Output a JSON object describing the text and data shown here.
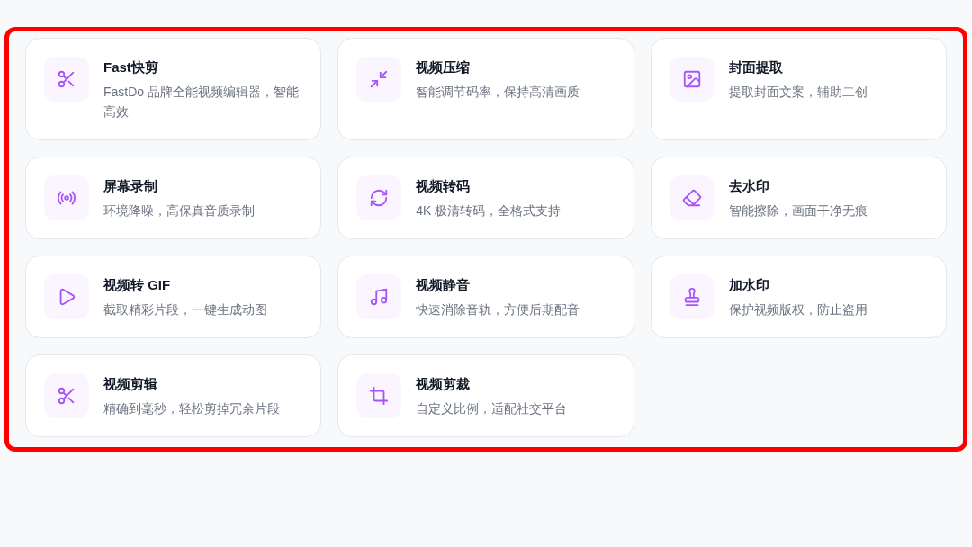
{
  "tools_grid": {
    "highlighted": true,
    "items": [
      {
        "kind": "scissors",
        "title": "Fast快剪",
        "description": "FastDo 品牌全能视频编辑器，智能高效"
      },
      {
        "kind": "compress",
        "title": "视频压缩",
        "description": "智能调节码率，保持高清画质"
      },
      {
        "kind": "image",
        "title": "封面提取",
        "description": "提取封面文案，辅助二创"
      },
      {
        "kind": "broadcast",
        "title": "屏幕录制",
        "description": "环境降噪，高保真音质录制"
      },
      {
        "kind": "refresh",
        "title": "视频转码",
        "description": "4K 极清转码，全格式支持"
      },
      {
        "kind": "eraser",
        "title": "去水印",
        "description": "智能擦除，画面干净无痕"
      },
      {
        "kind": "play",
        "title": "视频转 GIF",
        "description": "截取精彩片段，一键生成动图"
      },
      {
        "kind": "music",
        "title": "视频静音",
        "description": "快速消除音轨，方便后期配音"
      },
      {
        "kind": "stamp",
        "title": "加水印",
        "description": "保护视频版权，防止盗用"
      },
      {
        "kind": "scissors",
        "title": "视频剪辑",
        "description": "精确到毫秒，轻松剪掉冗余片段"
      },
      {
        "kind": "crop",
        "title": "视频剪裁",
        "description": "自定义比例，适配社交平台"
      }
    ]
  }
}
